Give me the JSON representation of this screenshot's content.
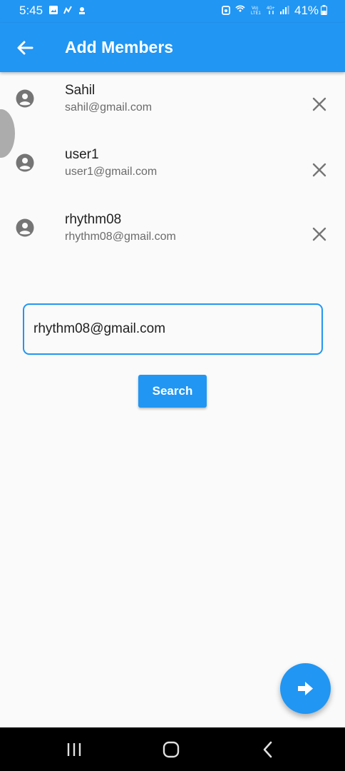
{
  "status_bar": {
    "time": "5:45",
    "battery": "41%",
    "icons": [
      "gallery-icon",
      "notification-icon",
      "notification-icon",
      "alarm-icon",
      "hotspot-icon",
      "volte-icon",
      "4g-icon",
      "signal-icon",
      "battery-icon"
    ]
  },
  "app_bar": {
    "title": "Add Members",
    "back_icon": "arrow-back-icon"
  },
  "members": [
    {
      "name": "Sahil",
      "email": "sahil@gmail.com"
    },
    {
      "name": "user1",
      "email": "user1@gmail.com"
    },
    {
      "name": "rhythm08",
      "email": "rhythm08@gmail.com"
    }
  ],
  "search": {
    "value": "rhythm08@gmail.com",
    "button_label": "Search"
  },
  "fab": {
    "icon": "arrow-forward-icon"
  },
  "nav": {
    "icons": [
      "recents-icon",
      "home-icon",
      "back-icon"
    ]
  },
  "colors": {
    "primary": "#2196f3",
    "background": "#fafafa",
    "icon_gray": "#757575"
  }
}
